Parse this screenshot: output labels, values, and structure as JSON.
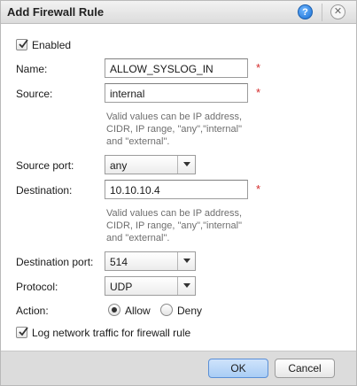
{
  "dialog": {
    "title": "Add Firewall Rule",
    "help_icon": "?",
    "close_icon": "✕"
  },
  "form": {
    "enabled": {
      "label": "Enabled",
      "checked": true
    },
    "name": {
      "label": "Name:",
      "value": "ALLOW_SYSLOG_IN",
      "required": "*"
    },
    "source": {
      "label": "Source:",
      "value": "internal",
      "required": "*",
      "hint": [
        "Valid values can be IP address,",
        "CIDR, IP range, \"any\",\"internal\"",
        "and \"external\"."
      ]
    },
    "source_port": {
      "label": "Source port:",
      "value": "any"
    },
    "destination": {
      "label": "Destination:",
      "value": "10.10.10.4",
      "required": "*",
      "hint": [
        "Valid values can be IP address,",
        "CIDR, IP range, \"any\",\"internal\"",
        "and \"external\"."
      ]
    },
    "destination_port": {
      "label": "Destination port:",
      "value": "514"
    },
    "protocol": {
      "label": "Protocol:",
      "value": "UDP"
    },
    "action": {
      "label": "Action:",
      "options": [
        "Allow",
        "Deny"
      ],
      "selected": "Allow"
    },
    "log": {
      "label": "Log network traffic for firewall rule",
      "checked": true
    }
  },
  "footer": {
    "ok_label": "OK",
    "cancel_label": "Cancel"
  },
  "colors": {
    "accent": "#5a8fd6",
    "required": "#d42a2a",
    "hint": "#6f6f6f"
  }
}
